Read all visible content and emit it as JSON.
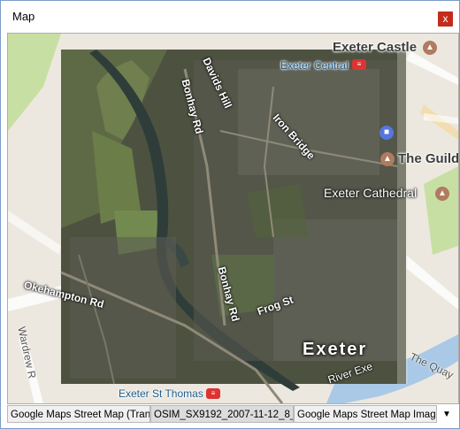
{
  "window": {
    "title": "Map",
    "close_glyph": "x"
  },
  "map": {
    "labels": {
      "exeter_castle": "Exeter Castle",
      "exeter_central": "Exeter Central",
      "davids_hill": "Davids Hill",
      "bonhay_rd_top": "Bonhay Rd",
      "iron_bridge": "Iron Bridge",
      "the_guild": "The Guild",
      "exeter_cathedral": "Exeter Cathedral",
      "okehampton_rd": "Okehampton Rd",
      "bonhay_rd_bottom": "Bonhay Rd",
      "frog_st": "Frog St",
      "exeter": "Exeter",
      "wardrew_rd": "Wardrew R",
      "river_exe": "River Exe",
      "the_quay": "The Quay",
      "exeter_st_thomas": "Exeter St Thomas"
    },
    "icons": [
      "museum-icon",
      "rail-icon",
      "shopping-icon",
      "place-icon"
    ],
    "colors": {
      "river": "#a9c9e6",
      "park": "#c8dfa3",
      "photo_dark": "#4a4f3c"
    }
  },
  "layers": {
    "tabs": [
      "Google Maps Street Map (Tran...",
      "OSIM_SX9192_2007-11-12_8_...",
      "Google Maps Street Map Image..."
    ],
    "dropdown_glyph": "▼"
  }
}
